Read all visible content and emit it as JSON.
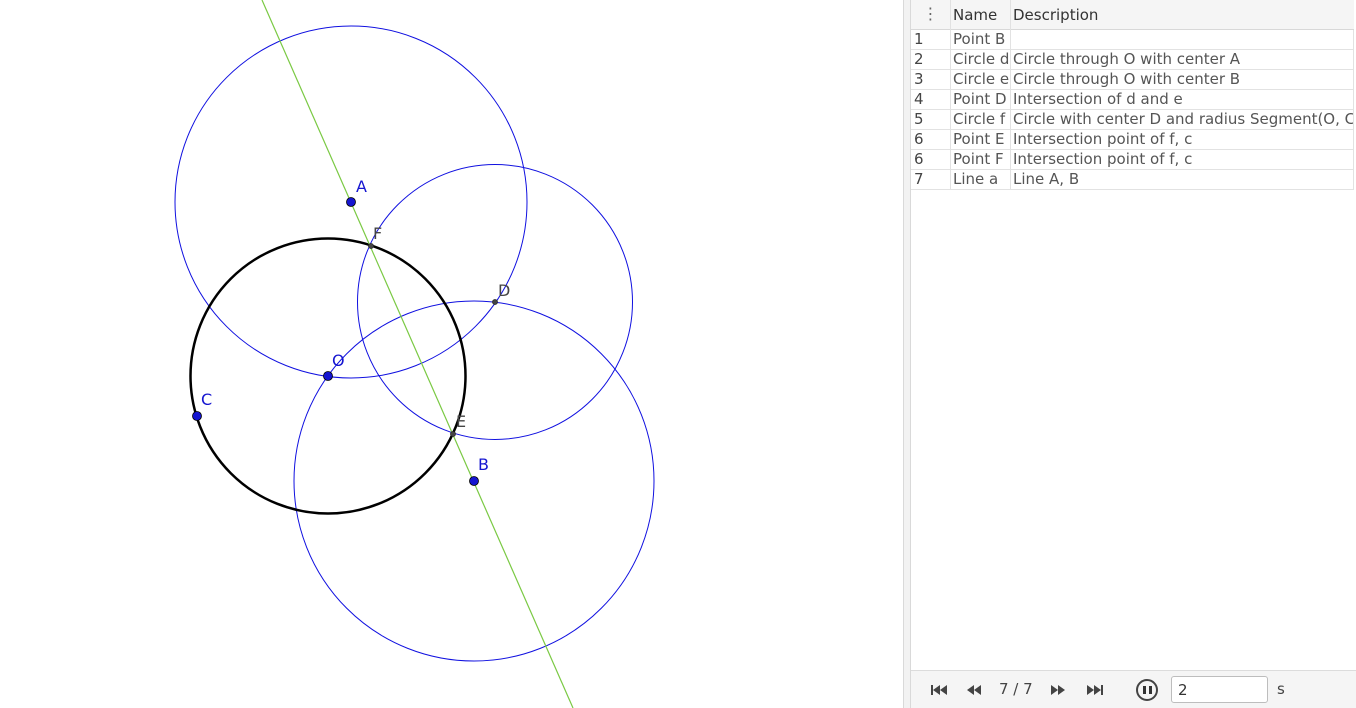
{
  "graphics": {
    "colors": {
      "line": "#7ac943",
      "circle": "#1010e0",
      "main_circle": "#000000",
      "free_point": "#1515d0",
      "dep_point": "#444444"
    },
    "points": [
      {
        "name": "A",
        "free": true
      },
      {
        "name": "F",
        "free": false
      },
      {
        "name": "D",
        "free": false
      },
      {
        "name": "O",
        "free": true
      },
      {
        "name": "C",
        "free": true
      },
      {
        "name": "E",
        "free": false
      },
      {
        "name": "B",
        "free": true
      }
    ]
  },
  "construction_protocol": {
    "columns": {
      "menu_icon": "vertical-dots-icon",
      "name": "Name",
      "description": "Description"
    },
    "rows": [
      {
        "num": "1",
        "name": "Point B",
        "description": ""
      },
      {
        "num": "2",
        "name": "Circle d",
        "description": "Circle through O with center A"
      },
      {
        "num": "3",
        "name": "Circle e",
        "description": "Circle through O with center B"
      },
      {
        "num": "4",
        "name": "Point D",
        "description": "Intersection of d and e"
      },
      {
        "num": "5",
        "name": "Circle f",
        "description": "Circle with center D and radius Segment(O, C)"
      },
      {
        "num": "6",
        "name": "Point E",
        "description": "Intersection point of f, c"
      },
      {
        "num": "6",
        "name": "Point F",
        "description": "Intersection point of f, c"
      },
      {
        "num": "7",
        "name": "Line a",
        "description": "Line A, B"
      }
    ]
  },
  "navigation": {
    "step": "7 / 7",
    "speed": "2",
    "unit": "s",
    "icons": [
      "skip-to-start-icon",
      "step-back-icon",
      "step-forward-icon",
      "skip-to-end-icon",
      "pause-icon"
    ]
  }
}
